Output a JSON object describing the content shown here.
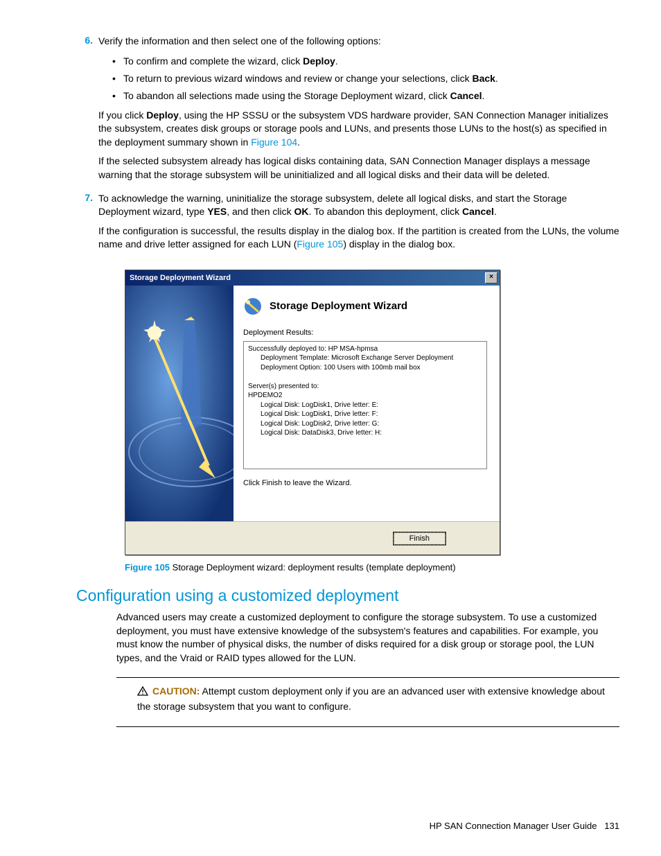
{
  "steps": {
    "s6": {
      "num": "6.",
      "text": "Verify the information and then select one of the following options:",
      "bullets": [
        {
          "pre": "To confirm and complete the wizard, click ",
          "bold": "Deploy",
          "post": "."
        },
        {
          "pre": "To return to previous wizard windows and review or change your selections, click ",
          "bold": "Back",
          "post": "."
        },
        {
          "pre": "To abandon all selections made using the Storage Deployment wizard, click ",
          "bold": "Cancel",
          "post": "."
        }
      ],
      "p1a": "If you click ",
      "p1bold": "Deploy",
      "p1b": ", using the HP SSSU or the subsystem VDS hardware provider, SAN Connection Manager initializes the subsystem, creates disk groups or storage pools and LUNs, and presents those LUNs to the host(s) as specified in the deployment summary shown in ",
      "p1link": "Figure 104",
      "p1c": ".",
      "p2": "If the selected subsystem already has logical disks containing data, SAN Connection Manager displays a message warning that the storage subsystem will be uninitialized and all logical disks and their data will be deleted."
    },
    "s7": {
      "num": "7.",
      "t1a": "To acknowledge the warning, uninitialize the storage subsystem, delete all logical disks, and start the Storage Deployment wizard, type ",
      "t1b1": "YES",
      "t1c": ", and then click ",
      "t1b2": "OK",
      "t1d": ". To abandon this deployment, click ",
      "t1b3": "Cancel",
      "t1e": ".",
      "p2a": "If the configuration is successful, the results display in the dialog box. If the partition is created from the LUNs, the volume name and drive letter assigned for each LUN (",
      "p2link": "Figure 105",
      "p2b": ") display in the dialog box."
    }
  },
  "dialog": {
    "title": "Storage Deployment Wizard",
    "close": "×",
    "heading": "Storage Deployment Wizard",
    "results_label": "Deployment Results:",
    "results": {
      "l1": "Successfully deployed to: HP MSA-hpmsa",
      "l2": "Deployment Template: Microsoft Exchange Server Deployment",
      "l3": "Deployment Option: 100 Users with 100mb mail box",
      "l4": "Server(s) presented to:",
      "l5": "HPDEMO2",
      "l6": "Logical Disk: LogDisk1, Drive letter: E:",
      "l7": "Logical Disk: LogDisk1, Drive letter: F:",
      "l8": "Logical Disk: LogDisk2, Drive letter: G:",
      "l9": "Logical Disk: DataDisk3, Drive letter: H:"
    },
    "hint": "Click Finish to leave the Wizard.",
    "finish": "Finish"
  },
  "figure": {
    "label": "Figure 105",
    "caption": " Storage Deployment wizard: deployment results (template deployment)"
  },
  "section": {
    "heading": "Configuration using a customized deployment",
    "para": "Advanced users may create a customized deployment to configure the storage subsystem. To use a customized deployment, you must have extensive knowledge of the subsystem's features and capabilities. For example, you must know the number of physical disks, the number of disks required for a disk group or storage pool, the LUN types, and the Vraid or RAID types allowed for the LUN."
  },
  "caution": {
    "label": "CAUTION:",
    "text": "   Attempt custom deployment only if you are an advanced user with extensive knowledge about the storage subsystem that you want to configure."
  },
  "footer": {
    "text": "HP SAN Connection Manager User Guide",
    "page": "131"
  }
}
